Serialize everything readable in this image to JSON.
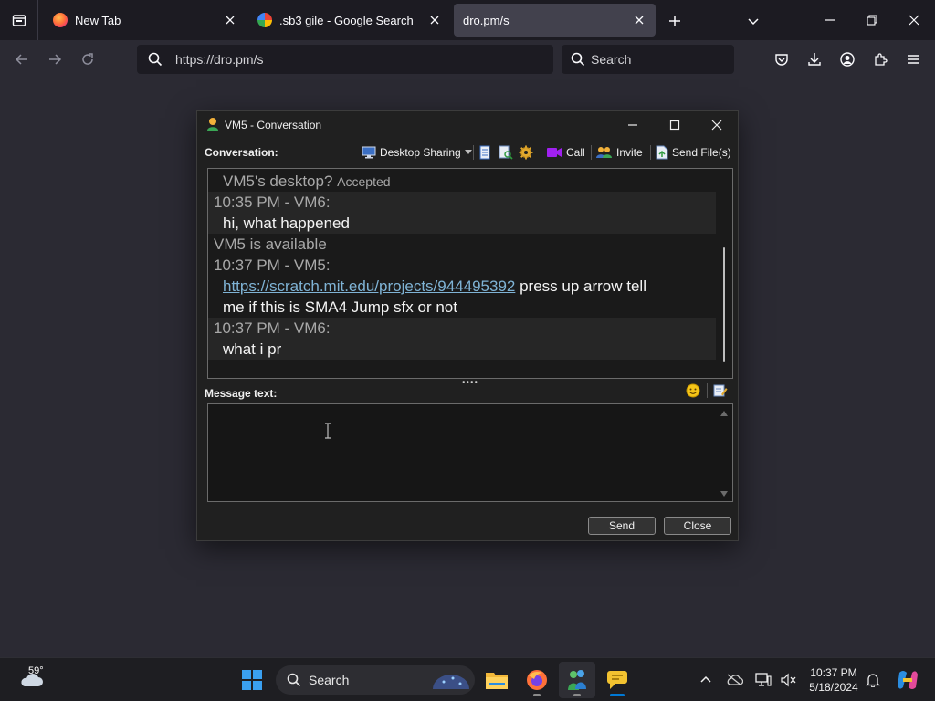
{
  "browser": {
    "tabs": [
      {
        "title": "New Tab",
        "active": false
      },
      {
        "title": ".sb3 gile - Google Search",
        "active": false
      },
      {
        "title": "dro.pm/s",
        "active": true
      }
    ],
    "url": "https://dro.pm/s",
    "search_placeholder": "Search"
  },
  "conversation": {
    "window_title": "VM5 - Conversation",
    "conversation_label": "Conversation:",
    "toolbar": {
      "desktop_sharing": "Desktop Sharing",
      "call": "Call",
      "invite": "Invite",
      "send_files": "Send File(s)"
    },
    "messages": [
      {
        "kind": "status",
        "text": "VM5's desktop?",
        "suffix": "Accepted"
      },
      {
        "kind": "header",
        "text": "10:35 PM - VM6:"
      },
      {
        "kind": "body",
        "text": "hi, what happened"
      },
      {
        "kind": "status",
        "text": "VM5 is available"
      },
      {
        "kind": "header",
        "text": "10:37 PM - VM5:"
      },
      {
        "kind": "body",
        "link": "https://scratch.mit.edu/projects/944495392",
        "text_after_link": " press up arrow tell",
        "text_line2": "me if this is SMA4 Jump sfx or not"
      },
      {
        "kind": "header",
        "text": "10:37 PM - VM6:"
      },
      {
        "kind": "body",
        "text": "what i pr"
      }
    ],
    "message_label": "Message text:",
    "message_value": "",
    "buttons": {
      "send": "Send",
      "close": "Close"
    }
  },
  "taskbar": {
    "weather_temp": "59°",
    "search_label": "Search",
    "clock_time": "10:37 PM",
    "clock_date": "5/18/2024"
  },
  "colors": {
    "accent_blue": "#0078d4",
    "link": "#7fb3d5",
    "call_purple": "#a020f0"
  }
}
